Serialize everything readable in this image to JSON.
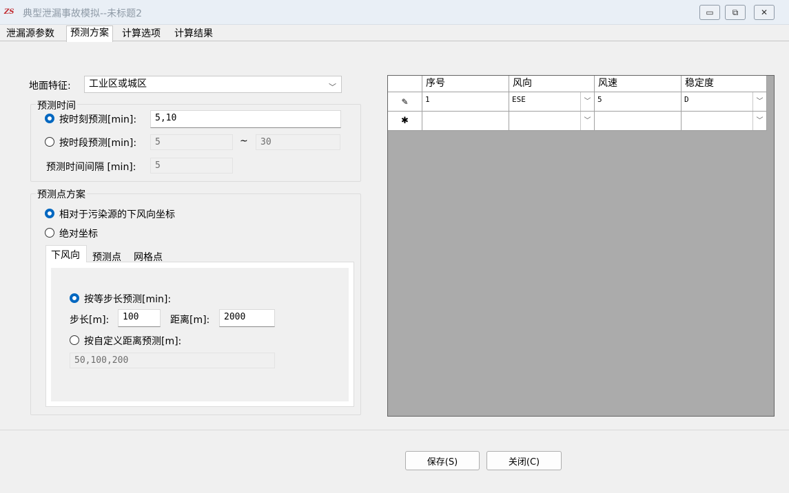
{
  "window": {
    "title": "典型泄漏事故模拟--未标题2",
    "logo_text": "ZS"
  },
  "window_controls": {
    "minimize": "▭",
    "restore": "⧉",
    "close": "✕"
  },
  "tabs": [
    "泄漏源参数",
    "预测方案",
    "计算选项",
    "计算结果"
  ],
  "ground": {
    "label": "地面特征:",
    "value": "工业区或城区"
  },
  "predict_time": {
    "group_label": "预测时间",
    "by_moment_label": "按时刻预测[min]:",
    "by_moment_value": "5,10",
    "by_period_label": "按时段预测[min]:",
    "period_start": "5",
    "tilde": "~",
    "period_end": "30",
    "interval_label": "预测时间间隔 [min]:",
    "interval_value": "5"
  },
  "points": {
    "group_label": "预测点方案",
    "relative_label": "相对于污染源的下风向坐标",
    "absolute_label": "绝对坐标",
    "subtabs": [
      "下风向",
      "预测点",
      "网格点"
    ],
    "equal_step_label": "按等步长预测[min]:",
    "step_label": "步长[m]:",
    "step_value": "100",
    "distance_label": "距离[m]:",
    "distance_value": "2000",
    "custom_label": "按自定义距离预测[m]:",
    "custom_value": "50,100,200"
  },
  "grid": {
    "headers": [
      "序号",
      "风向",
      "风速",
      "稳定度"
    ],
    "rows": [
      {
        "marker": "✎",
        "no": "1",
        "dir": "ESE",
        "speed": "5",
        "stability": "D"
      },
      {
        "marker": "✱",
        "no": "",
        "dir": "",
        "speed": "",
        "stability": ""
      }
    ]
  },
  "buttons": {
    "save": "保存(S)",
    "close": "关闭(C)"
  },
  "colors": {
    "accent": "#0067c0",
    "grid_bg": "#ababab",
    "logo": "#c0282d"
  }
}
